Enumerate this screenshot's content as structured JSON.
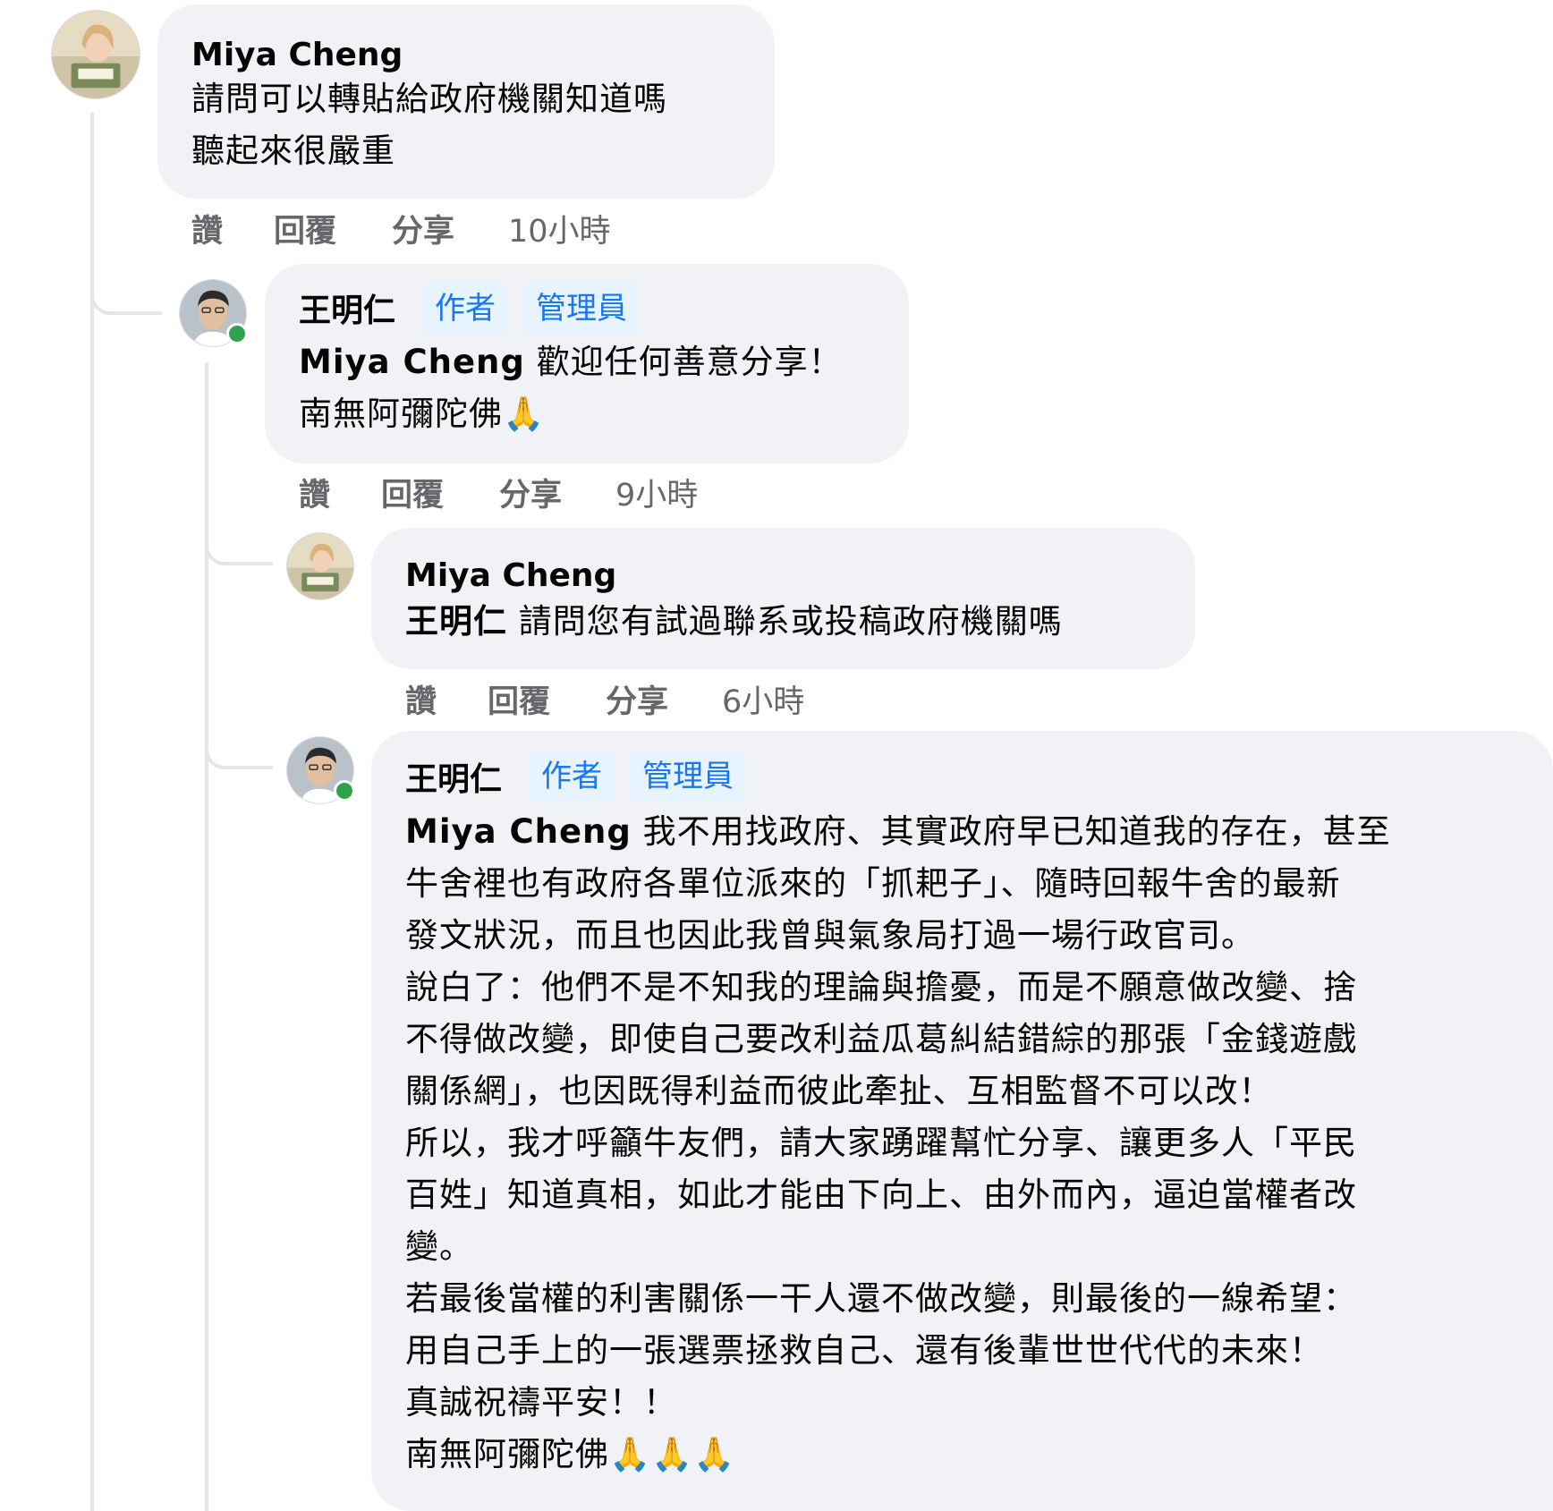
{
  "comments": [
    {
      "author": "Miya Cheng",
      "lines": [
        "請問可以轉貼給政府機關知道嗎",
        "聽起來很嚴重"
      ],
      "actions": {
        "like": "讚",
        "reply": "回覆",
        "share": "分享",
        "time": "10小時"
      }
    },
    {
      "author": "王明仁",
      "badges": [
        "作者",
        "管理員"
      ],
      "mention": "Miya Cheng",
      "lines": [
        "歡迎任何善意分享！",
        "南無阿彌陀佛🙏"
      ],
      "actions": {
        "like": "讚",
        "reply": "回覆",
        "share": "分享",
        "time": "9小時"
      }
    },
    {
      "author": "Miya Cheng",
      "mention": "王明仁",
      "lines": [
        "請問您有試過聯系或投稿政府機關嗎"
      ],
      "actions": {
        "like": "讚",
        "reply": "回覆",
        "share": "分享",
        "time": "6小時"
      }
    },
    {
      "author": "王明仁",
      "badges": [
        "作者",
        "管理員"
      ],
      "mention": "Miya Cheng",
      "lines": [
        "我不用找政府、其實政府早已知道我的存在，甚至",
        "牛舍裡也有政府各單位派來的「抓耙子」、隨時回報牛舍的最新",
        "發文狀況，而且也因此我曾與氣象局打過一場行政官司。",
        "說白了：他們不是不知我的理論與擔憂，而是不願意做改變、捨",
        "不得做改變，即使自己要改利益瓜葛糾結錯綜的那張「金錢遊戲",
        "關係網」，也因既得利益而彼此牽扯、互相監督不可以改！",
        "所以，我才呼籲牛友們，請大家踴躍幫忙分享、讓更多人「平民",
        "百姓」知道真相，如此才能由下向上、由外而內，逼迫當權者改",
        "變。",
        "若最後當權的利害關係一干人還不做改變，則最後的一線希望：",
        "用自己手上的一張選票拯救自己、還有後輩世世代代的未來！",
        "真誠祝禱平安！！",
        "南無阿彌陀佛🙏🙏🙏"
      ]
    }
  ]
}
